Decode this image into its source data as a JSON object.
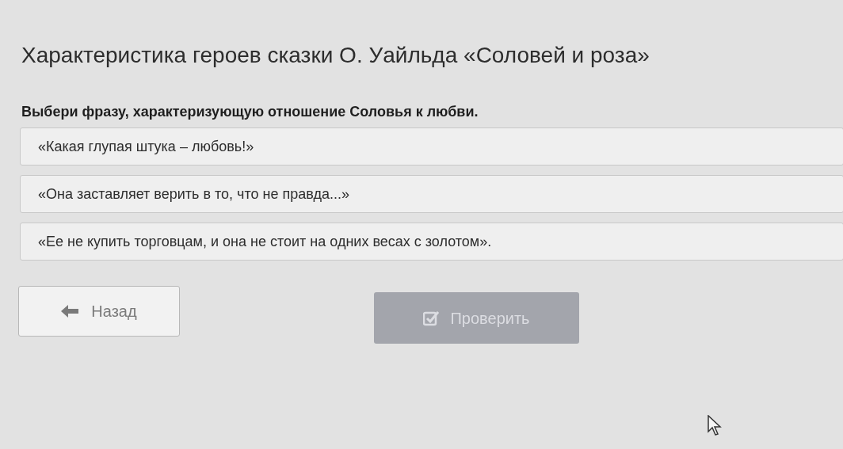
{
  "title": "Характеристика героев сказки О. Уайльда «Соловей и роза»",
  "question": "Выбери фразу, характеризующую отношение Соловья к любви.",
  "options": [
    {
      "label": "«Какая глупая штука – любовь!»",
      "selected": false
    },
    {
      "label": "«Она заставляет верить в то, что не правда...»",
      "selected": false
    },
    {
      "label": "«Ее не купить торговцам, и она не стоит на одних весах с золотом».",
      "selected": false
    }
  ],
  "back_button": {
    "label": "Назад"
  },
  "check_button": {
    "label": "Проверить",
    "disabled": true
  }
}
